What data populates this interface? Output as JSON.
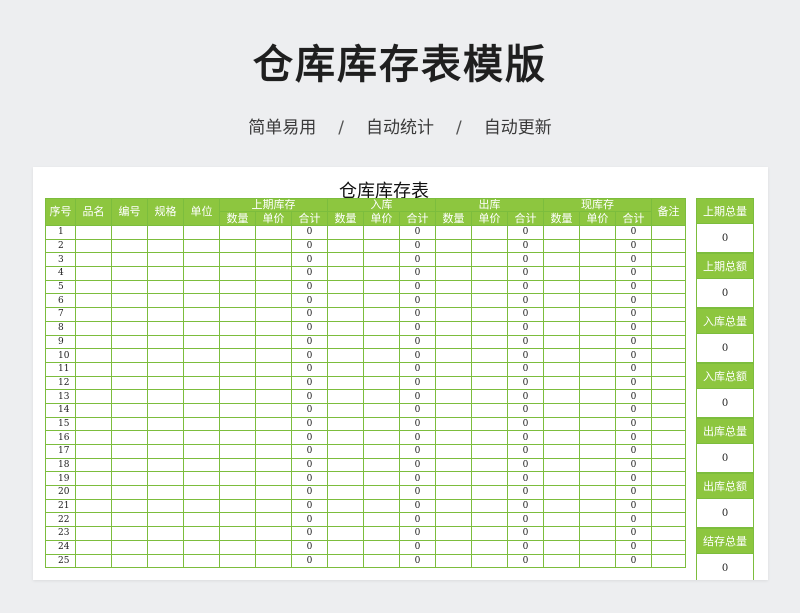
{
  "header": {
    "title": "仓库库存表模版",
    "features": [
      "简单易用",
      "自动统计",
      "自动更新"
    ],
    "separator": "/"
  },
  "sheet": {
    "title": "仓库库存表",
    "columns": {
      "seq": "序号",
      "name": "品名",
      "code": "编号",
      "spec": "规格",
      "unit": "单位",
      "groups": [
        "上期库存",
        "入库",
        "出库",
        "现库存"
      ],
      "sub": [
        "数量",
        "单价",
        "合计"
      ],
      "remark": "备注"
    },
    "rows": [
      {
        "no": "1",
        "totals": [
          "0",
          "0",
          "0",
          "0"
        ]
      },
      {
        "no": "2",
        "totals": [
          "0",
          "0",
          "0",
          "0"
        ]
      },
      {
        "no": "3",
        "totals": [
          "0",
          "0",
          "0",
          "0"
        ]
      },
      {
        "no": "4",
        "totals": [
          "0",
          "0",
          "0",
          "0"
        ]
      },
      {
        "no": "5",
        "totals": [
          "0",
          "0",
          "0",
          "0"
        ]
      },
      {
        "no": "6",
        "totals": [
          "0",
          "0",
          "0",
          "0"
        ]
      },
      {
        "no": "7",
        "totals": [
          "0",
          "0",
          "0",
          "0"
        ]
      },
      {
        "no": "8",
        "totals": [
          "0",
          "0",
          "0",
          "0"
        ]
      },
      {
        "no": "9",
        "totals": [
          "0",
          "0",
          "0",
          "0"
        ]
      },
      {
        "no": "10",
        "totals": [
          "0",
          "0",
          "0",
          "0"
        ]
      },
      {
        "no": "11",
        "totals": [
          "0",
          "0",
          "0",
          "0"
        ]
      },
      {
        "no": "12",
        "totals": [
          "0",
          "0",
          "0",
          "0"
        ]
      },
      {
        "no": "13",
        "totals": [
          "0",
          "0",
          "0",
          "0"
        ]
      },
      {
        "no": "14",
        "totals": [
          "0",
          "0",
          "0",
          "0"
        ]
      },
      {
        "no": "15",
        "totals": [
          "0",
          "0",
          "0",
          "0"
        ]
      },
      {
        "no": "16",
        "totals": [
          "0",
          "0",
          "0",
          "0"
        ]
      },
      {
        "no": "17",
        "totals": [
          "0",
          "0",
          "0",
          "0"
        ]
      },
      {
        "no": "18",
        "totals": [
          "0",
          "0",
          "0",
          "0"
        ]
      },
      {
        "no": "19",
        "totals": [
          "0",
          "0",
          "0",
          "0"
        ]
      },
      {
        "no": "20",
        "totals": [
          "0",
          "0",
          "0",
          "0"
        ]
      },
      {
        "no": "21",
        "totals": [
          "0",
          "0",
          "0",
          "0"
        ]
      },
      {
        "no": "22",
        "totals": [
          "0",
          "0",
          "0",
          "0"
        ]
      },
      {
        "no": "23",
        "totals": [
          "0",
          "0",
          "0",
          "0"
        ]
      },
      {
        "no": "24",
        "totals": [
          "0",
          "0",
          "0",
          "0"
        ]
      },
      {
        "no": "25",
        "totals": [
          "0",
          "0",
          "0",
          "0"
        ]
      }
    ]
  },
  "summary": [
    {
      "label": "上期总量",
      "value": "0"
    },
    {
      "label": "上期总额",
      "value": "0"
    },
    {
      "label": "入库总量",
      "value": "0"
    },
    {
      "label": "入库总额",
      "value": "0"
    },
    {
      "label": "出库总量",
      "value": "0"
    },
    {
      "label": "出库总额",
      "value": "0"
    },
    {
      "label": "结存总量",
      "value": "0"
    }
  ],
  "colors": {
    "header_green": "#8dc63f",
    "grid_green": "#7cbd3d",
    "background": "#edeef0"
  }
}
